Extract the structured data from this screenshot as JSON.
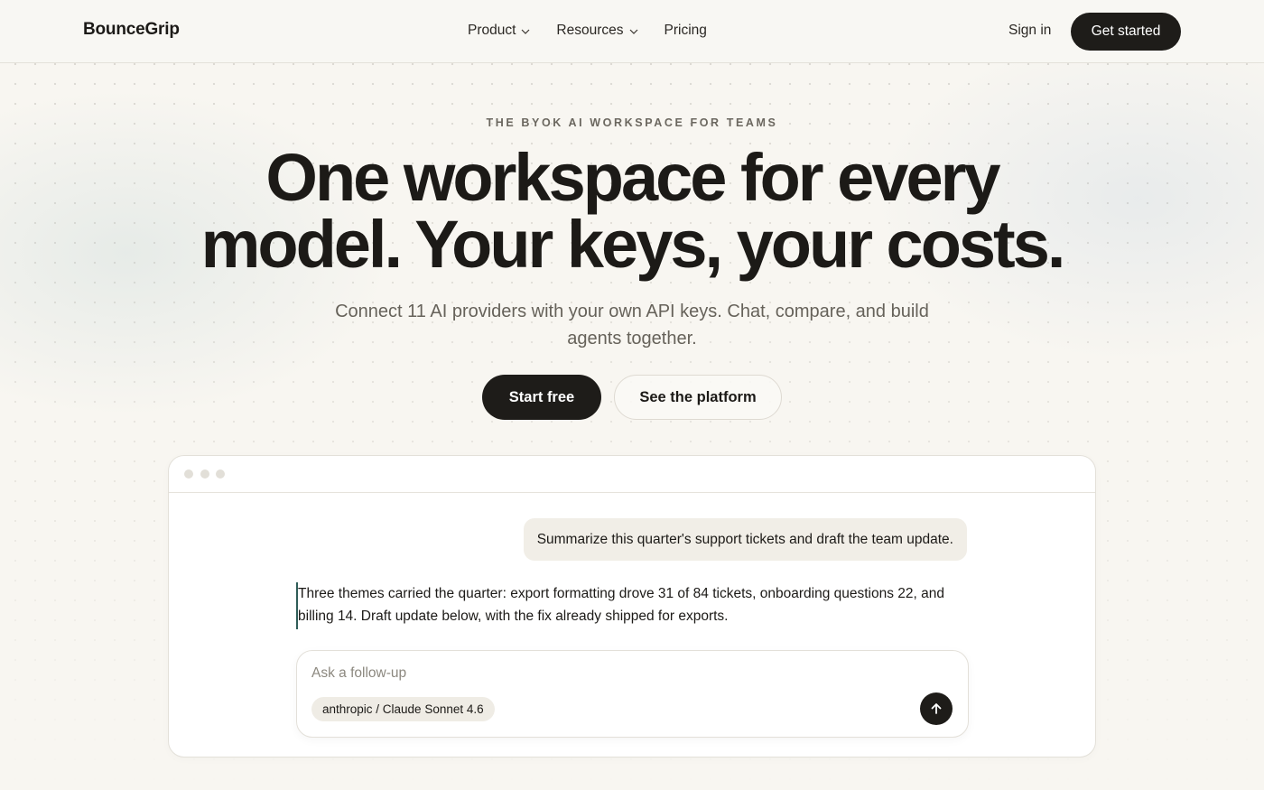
{
  "brand": {
    "name": "BounceGrip"
  },
  "nav": {
    "links": [
      {
        "label": "Product",
        "has_dropdown": true
      },
      {
        "label": "Resources",
        "has_dropdown": true
      },
      {
        "label": "Pricing",
        "has_dropdown": false
      }
    ],
    "sign_in": "Sign in",
    "get_started": "Get started"
  },
  "hero": {
    "eyebrow": "THE BYOK AI WORKSPACE FOR TEAMS",
    "headline_line1": "One workspace for every",
    "headline_line2": "model. Your keys, your costs.",
    "subhead": "Connect 11 AI providers with your own API keys. Chat, compare, and build agents together.",
    "primary_cta": "Start free",
    "secondary_cta": "See the platform"
  },
  "app_preview": {
    "user_message": "Summarize this quarter's support tickets and draft the team update.",
    "assistant_reply": "Three themes carried the quarter: export formatting drove 31 of 84 tickets, onboarding questions 22, and billing 14. Draft update below, with the fix already shipped for exports.",
    "composer": {
      "placeholder": "Ask a follow-up",
      "value": "",
      "model": "anthropic / Claude Sonnet 4.6",
      "send_icon": "arrow-up-icon"
    }
  },
  "colors": {
    "background": "#f8f6f1",
    "primary_button": "#1e1c19",
    "accent": "#2f5d58",
    "text": "#1c1a17",
    "muted_text": "#66625a"
  }
}
